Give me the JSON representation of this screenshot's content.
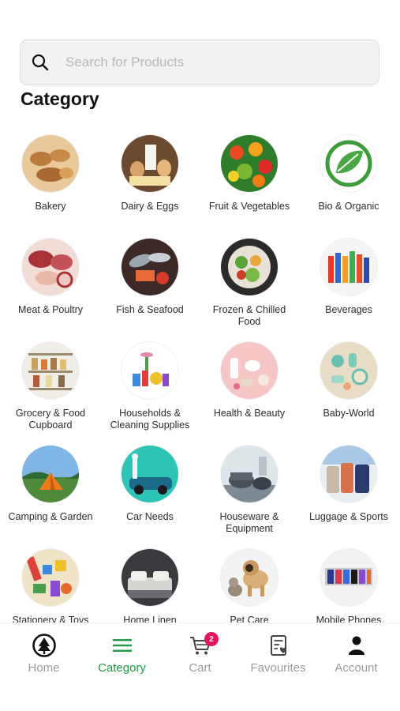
{
  "search": {
    "placeholder": "Search for Products",
    "icon": "search-icon"
  },
  "page_title": "Category",
  "categories": [
    {
      "label": "Bakery",
      "icon": "bakery-image"
    },
    {
      "label": "Dairy & Eggs",
      "icon": "dairy-eggs-image"
    },
    {
      "label": "Fruit & Vegetables",
      "icon": "fruit-vegetables-image"
    },
    {
      "label": "Bio & Organic",
      "icon": "bio-organic-leaf-image"
    },
    {
      "label": "Meat & Poultry",
      "icon": "meat-poultry-image"
    },
    {
      "label": "Fish & Seafood",
      "icon": "fish-seafood-image"
    },
    {
      "label": "Frozen & Chilled Food",
      "icon": "frozen-chilled-image"
    },
    {
      "label": "Beverages",
      "icon": "beverages-image"
    },
    {
      "label": "Grocery & Food Cupboard",
      "icon": "grocery-cupboard-image"
    },
    {
      "label": "Households & Cleaning Supplies",
      "icon": "household-cleaning-image"
    },
    {
      "label": "Health & Beauty",
      "icon": "health-beauty-image"
    },
    {
      "label": "Baby-World",
      "icon": "baby-world-image"
    },
    {
      "label": "Camping & Garden",
      "icon": "camping-garden-image"
    },
    {
      "label": "Car Needs",
      "icon": "car-needs-image"
    },
    {
      "label": "Houseware & Equipment",
      "icon": "houseware-image"
    },
    {
      "label": "Luggage & Sports",
      "icon": "luggage-sports-image"
    },
    {
      "label": "Stationery & Toys",
      "icon": "stationery-toys-image"
    },
    {
      "label": "Home Linen",
      "icon": "home-linen-image"
    },
    {
      "label": "Pet Care",
      "icon": "pet-care-image"
    },
    {
      "label": "Mobile Phones Tablets &",
      "icon": "mobile-phones-image"
    }
  ],
  "tabbar": {
    "home": {
      "label": "Home",
      "icon": "home-tree-icon"
    },
    "category": {
      "label": "Category",
      "icon": "menu-icon"
    },
    "cart": {
      "label": "Cart",
      "icon": "cart-icon",
      "badge": "2"
    },
    "favourites": {
      "label": "Favourites",
      "icon": "favourites-list-icon"
    },
    "account": {
      "label": "Account",
      "icon": "account-icon"
    }
  },
  "colors": {
    "accent": "#1e9b46",
    "badge": "#e6155b",
    "inactive": "#9a9a9a"
  }
}
